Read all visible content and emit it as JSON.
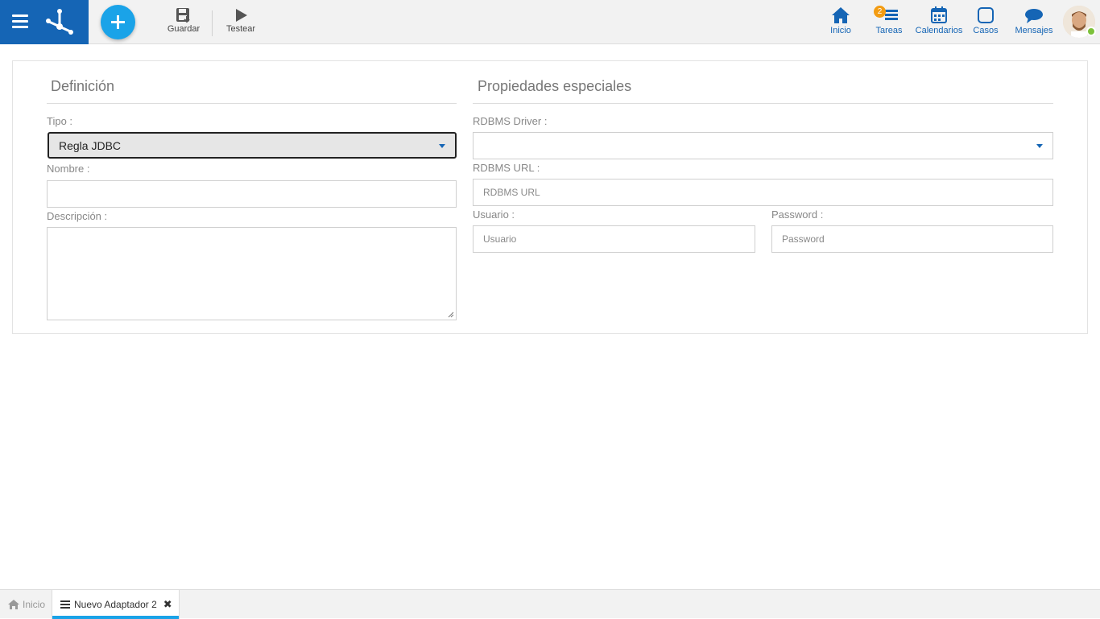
{
  "toolbar": {
    "save_label": "Guardar",
    "test_label": "Testear"
  },
  "nav": {
    "inicio": "Inicio",
    "tareas": "Tareas",
    "tareas_badge": "2",
    "calendarios": "Calendarios",
    "casos": "Casos",
    "mensajes": "Mensajes"
  },
  "definition": {
    "title": "Definición",
    "tipo_label": "Tipo :",
    "tipo_value": "Regla JDBC",
    "nombre_label": "Nombre :",
    "nombre_value": "",
    "descripcion_label": "Descripción :",
    "descripcion_value": ""
  },
  "special": {
    "title": "Propiedades especiales",
    "driver_label": "RDBMS Driver :",
    "driver_value": "",
    "url_label": "RDBMS URL :",
    "url_placeholder": "RDBMS URL",
    "usuario_label": "Usuario :",
    "usuario_placeholder": "Usuario",
    "password_label": "Password :",
    "password_placeholder": "Password"
  },
  "tabs": {
    "home_label": "Inicio",
    "active_label": "Nuevo Adaptador 2",
    "close_glyph": "✖"
  },
  "colors": {
    "brand": "#1565b5",
    "accent": "#1aa3e8",
    "badge": "#f39c12",
    "online": "#7cc13a"
  }
}
